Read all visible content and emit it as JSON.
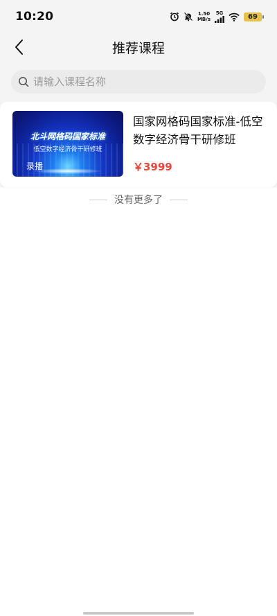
{
  "status_bar": {
    "time": "10:20",
    "net_speed_value": "1.50",
    "net_speed_unit": "MB/s",
    "network": "5G",
    "battery": "69",
    "icons": [
      "alarm-icon",
      "mute-bell-icon",
      "signal-icon",
      "wifi-icon",
      "battery-icon"
    ]
  },
  "nav": {
    "title": "推荐课程",
    "back_icon": "chevron-left-icon"
  },
  "search": {
    "placeholder": "请输入课程名称",
    "value": "",
    "icon": "search-icon"
  },
  "courses": [
    {
      "thumbnail": {
        "title": "北斗网格码国家标准",
        "subtitle": "低空数字经济骨干研修班",
        "tag": "录播"
      },
      "title": "国家网格码国家标准-低空数字经济骨干研修班",
      "price": "￥3999"
    }
  ],
  "list_end_text": "没有更多了",
  "colors": {
    "price": "#e8473b",
    "background_top": "#f4f4f4",
    "search_bg": "#ebebeb",
    "battery": "#e6c24a"
  }
}
